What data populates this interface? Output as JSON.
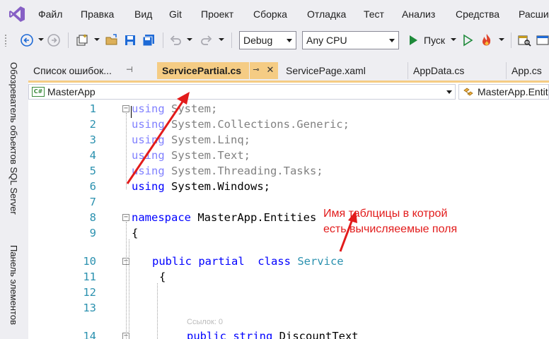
{
  "menu": {
    "items": [
      "Файл",
      "Правка",
      "Вид",
      "Git",
      "Проект",
      "Сборка",
      "Отладка",
      "Тест",
      "Анализ",
      "Средства",
      "Расши"
    ]
  },
  "toolbar": {
    "configuration": "Debug",
    "platform": "Any CPU",
    "start_label": "Пуск"
  },
  "side_panel": {
    "tabs": [
      "Обозреватель объектов SQL Server",
      "Панель элементов"
    ]
  },
  "tabs": [
    {
      "label": "Список ошибок...",
      "active": false
    },
    {
      "label": "ServicePartial.cs",
      "active": true
    },
    {
      "label": "ServicePage.xaml",
      "active": false
    },
    {
      "label": "AppData.cs",
      "active": false
    },
    {
      "label": "App.cs",
      "active": false
    }
  ],
  "navbar": {
    "project": "MasterApp",
    "type": "MasterApp.Entit"
  },
  "editor": {
    "lines": [
      {
        "num": "1",
        "kw": "using",
        "rest": " System;"
      },
      {
        "num": "2",
        "kw": "using",
        "rest": " System.Collections.Generic;"
      },
      {
        "num": "3",
        "kw": "using",
        "rest": " System.Linq;"
      },
      {
        "num": "4",
        "kw": "using",
        "rest": " System.Text;"
      },
      {
        "num": "5",
        "kw": "using",
        "rest": " System.Threading.Tasks;"
      },
      {
        "num": "6",
        "kw": "using",
        "rest": " System.Windows;"
      },
      {
        "num": "7"
      },
      {
        "num": "8",
        "kw": "namespace",
        "rest": " MasterApp.Entities"
      },
      {
        "num": "9",
        "rest": "{"
      },
      {
        "num": "10",
        "kw": "public partial  class",
        "type": "Service"
      },
      {
        "num": "11",
        "rest": "{"
      },
      {
        "num": "12"
      },
      {
        "num": "13"
      },
      {
        "num": "14",
        "kw": "public string",
        "rest": " DiscountText"
      }
    ],
    "codelens": "Ссылок: 0"
  },
  "annotation": {
    "line1": "Имя таблцицы в котрой",
    "line2": "есть вычисляеемые поля",
    "color": "#e21b1b"
  }
}
